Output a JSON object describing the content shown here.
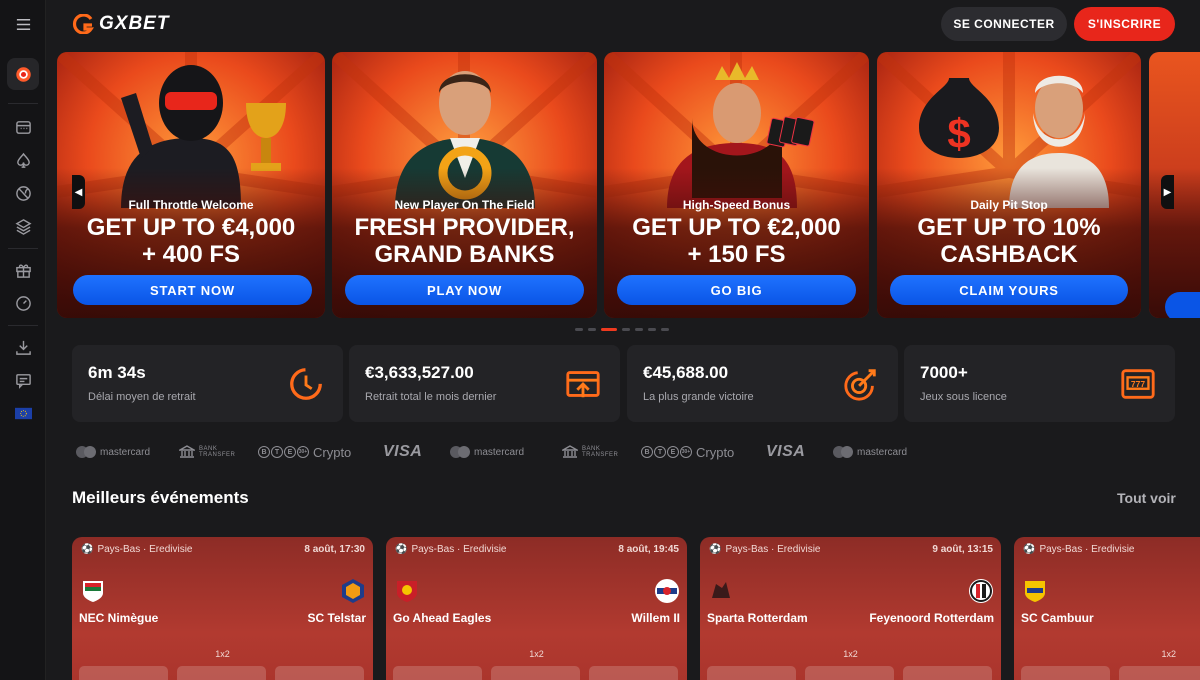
{
  "brand": {
    "name": "GXBET"
  },
  "header": {
    "login_label": "SE CONNECTER",
    "signup_label": "S'INSCRIRE"
  },
  "sidebar": {
    "items": [
      {
        "icon": "menu-icon"
      },
      {
        "icon": "casino-chip-icon",
        "active": true
      },
      {
        "icon": "slots-icon"
      },
      {
        "icon": "spade-icon"
      },
      {
        "icon": "ball-icon"
      },
      {
        "icon": "layers-icon"
      },
      {
        "icon": "gift-icon"
      },
      {
        "icon": "gauge-icon"
      },
      {
        "icon": "download-icon"
      },
      {
        "icon": "chat-icon"
      },
      {
        "icon": "eu-flag-icon"
      }
    ]
  },
  "promos": [
    {
      "subtitle": "Full Throttle Welcome",
      "line1": "GET UP TO €4,000",
      "line2": "+ 400 FS",
      "cta": "START NOW"
    },
    {
      "subtitle": "New Player On The Field",
      "line1": "FRESH PROVIDER,",
      "line2": "GRAND BANKS",
      "cta": "PLAY NOW"
    },
    {
      "subtitle": "High-Speed Bonus",
      "line1": "GET UP TO €2,000",
      "line2": "+ 150 FS",
      "cta": "GO BIG"
    },
    {
      "subtitle": "Daily Pit Stop",
      "line1": "GET UP TO 10%",
      "line2": "CASHBACK",
      "cta": "CLAIM YOURS"
    }
  ],
  "carousel": {
    "active_index": 2,
    "count": 7
  },
  "stats": [
    {
      "value": "6m 34s",
      "label": "Délai moyen de retrait",
      "icon": "clock-icon"
    },
    {
      "value": "€3,633,527.00",
      "label": "Retrait total le mois dernier",
      "icon": "wallet-icon"
    },
    {
      "value": "€45,688.00",
      "label": "La plus grande victoire",
      "icon": "target-icon"
    },
    {
      "value": "7000+",
      "label": "Jeux sous licence",
      "icon": "slot-machine-icon"
    }
  ],
  "payments": {
    "mastercard": "mastercard",
    "bank_top": "BANK",
    "bank_bottom": "TRANSFER",
    "crypto": "Crypto",
    "visa": "VISA",
    "coin_b": "B",
    "coin_t": "T",
    "coin_e": "E",
    "coin_more": "30+"
  },
  "events_section": {
    "title": "Meilleurs événements",
    "see_all": "Tout voir"
  },
  "events": [
    {
      "league": "Pays-Bas · Eredivisie",
      "date": "8 août, 17:30",
      "home": "NEC Nimègue",
      "away": "SC Telstar",
      "market": "1x2"
    },
    {
      "league": "Pays-Bas · Eredivisie",
      "date": "8 août, 19:45",
      "home": "Go Ahead Eagles",
      "away": "Willem II",
      "market": "1x2"
    },
    {
      "league": "Pays-Bas · Eredivisie",
      "date": "9 août, 13:15",
      "home": "Sparta Rotterdam",
      "away": "Feyenoord Rotterdam",
      "market": "1x2"
    },
    {
      "league": "Pays-Bas · Eredivisie",
      "date": "",
      "home": "SC Cambuur",
      "away": "",
      "market": "1x2"
    }
  ],
  "colors": {
    "accent_red": "#e8261b",
    "cta_blue": "#0a55e6",
    "panel": "#232326"
  }
}
